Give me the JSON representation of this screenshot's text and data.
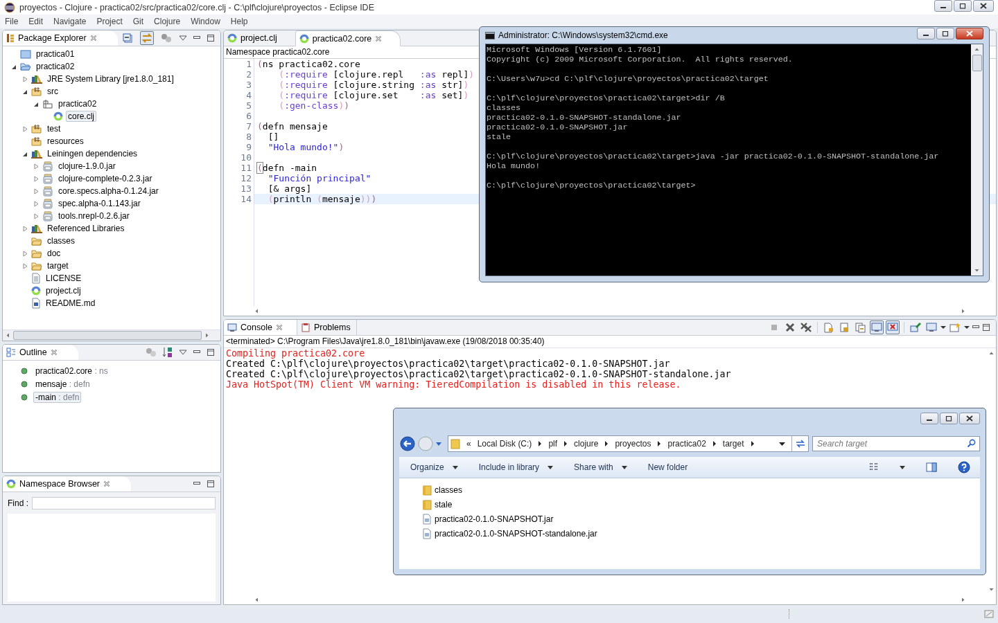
{
  "window": {
    "title": "proyectos - Clojure - practica02/src/practica02/core.clj - C:\\plf\\clojure\\proyectos - Eclipse IDE"
  },
  "menu": [
    "File",
    "Edit",
    "Navigate",
    "Project",
    "Git",
    "Clojure",
    "Window",
    "Help"
  ],
  "package_explorer": {
    "title": "Package Explorer",
    "toolbar": [
      {
        "pressed": false
      },
      {
        "pressed": true
      },
      {
        "pressed": false
      }
    ],
    "tree": [
      {
        "label": "practica01",
        "kind": "project-closed",
        "selected": false
      },
      {
        "label": "practica02",
        "kind": "project",
        "selected": false,
        "expanded": true,
        "children": [
          {
            "label": "JRE System Library [jre1.8.0_181]",
            "kind": "library",
            "selected": false,
            "expanded": false
          },
          {
            "label": "src",
            "kind": "source-folder",
            "selected": false,
            "expanded": true,
            "children": [
              {
                "label": "practica02",
                "kind": "package",
                "selected": false,
                "expanded": true,
                "children": [
                  {
                    "label": "core.clj",
                    "kind": "clj",
                    "selected": true
                  }
                ]
              }
            ]
          },
          {
            "label": "test",
            "kind": "source-folder",
            "selected": false,
            "expanded": false
          },
          {
            "label": "resources",
            "kind": "source-folder",
            "selected": false
          },
          {
            "label": "Leiningen dependencies",
            "kind": "library",
            "selected": false,
            "expanded": true,
            "children": [
              {
                "label": "clojure-1.9.0.jar",
                "kind": "jar",
                "selected": false,
                "expanded": false
              },
              {
                "label": "clojure-complete-0.2.3.jar",
                "kind": "jar",
                "selected": false,
                "expanded": false
              },
              {
                "label": "core.specs.alpha-0.1.24.jar",
                "kind": "jar",
                "selected": false,
                "expanded": false
              },
              {
                "label": "spec.alpha-0.1.143.jar",
                "kind": "jar",
                "selected": false,
                "expanded": false
              },
              {
                "label": "tools.nrepl-0.2.6.jar",
                "kind": "jar",
                "selected": false,
                "expanded": false
              }
            ]
          },
          {
            "label": "Referenced Libraries",
            "kind": "library",
            "selected": false,
            "expanded": false
          },
          {
            "label": "classes",
            "kind": "folder",
            "selected": false
          },
          {
            "label": "doc",
            "kind": "folder",
            "selected": false,
            "expanded": false
          },
          {
            "label": "target",
            "kind": "folder",
            "selected": false,
            "expanded": false
          },
          {
            "label": "LICENSE",
            "kind": "text-file",
            "selected": false
          },
          {
            "label": "project.clj",
            "kind": "clj",
            "selected": false
          },
          {
            "label": "README.md",
            "kind": "word-file",
            "selected": false
          }
        ]
      }
    ]
  },
  "outline": {
    "title": "Outline",
    "items": [
      {
        "name": "practica02.core",
        "type": ": ns",
        "selected": false
      },
      {
        "name": "mensaje",
        "type": ": defn",
        "selected": false
      },
      {
        "name": "-main",
        "type": ": defn",
        "selected": true
      }
    ]
  },
  "namespace_browser": {
    "title": "Namespace Browser",
    "find_label": "Find :"
  },
  "editor": {
    "tabs": [
      {
        "label": "project.clj",
        "selected": false
      },
      {
        "label": "practica02.core",
        "selected": true
      }
    ],
    "breadcrumb": "Namespace practica02.core",
    "lines": [
      {
        "number": "1",
        "current": false,
        "tokens": [
          {
            "kind": "paren1",
            "text": "("
          },
          {
            "kind": "plain",
            "text": "ns practica02.core"
          }
        ]
      },
      {
        "number": "2",
        "current": false,
        "tokens": [
          {
            "kind": "paren2",
            "text": "    ("
          },
          {
            "kind": "keyword",
            "text": ":require"
          },
          {
            "kind": "plain",
            "text": " [clojure.repl   "
          },
          {
            "kind": "keyword",
            "text": ":as"
          },
          {
            "kind": "plain",
            "text": " repl]"
          },
          {
            "kind": "paren2",
            "text": ")"
          }
        ]
      },
      {
        "number": "3",
        "current": false,
        "tokens": [
          {
            "kind": "paren2",
            "text": "    ("
          },
          {
            "kind": "keyword",
            "text": ":require"
          },
          {
            "kind": "plain",
            "text": " [clojure.string "
          },
          {
            "kind": "keyword",
            "text": ":as"
          },
          {
            "kind": "plain",
            "text": " str]"
          },
          {
            "kind": "paren2",
            "text": ")"
          }
        ]
      },
      {
        "number": "4",
        "current": false,
        "tokens": [
          {
            "kind": "paren2",
            "text": "    ("
          },
          {
            "kind": "keyword",
            "text": ":require"
          },
          {
            "kind": "plain",
            "text": " [clojure.set    "
          },
          {
            "kind": "keyword",
            "text": ":as"
          },
          {
            "kind": "plain",
            "text": " set]"
          },
          {
            "kind": "paren2",
            "text": ")"
          }
        ]
      },
      {
        "number": "5",
        "current": false,
        "tokens": [
          {
            "kind": "paren2",
            "text": "    ("
          },
          {
            "kind": "keyword",
            "text": ":gen-class"
          },
          {
            "kind": "paren2",
            "text": ")"
          },
          {
            "kind": "paren1",
            "text": ")"
          }
        ]
      },
      {
        "number": "6",
        "current": false
      },
      {
        "number": "7",
        "current": false,
        "tokens": [
          {
            "kind": "paren1",
            "text": "("
          },
          {
            "kind": "plain",
            "text": "defn mensaje"
          }
        ]
      },
      {
        "number": "8",
        "current": false,
        "tokens": [
          {
            "kind": "plain",
            "text": "  []"
          }
        ]
      },
      {
        "number": "9",
        "current": false,
        "tokens": [
          {
            "kind": "string",
            "text": "  \"Hola mundo!\""
          },
          {
            "kind": "paren1",
            "text": ")"
          }
        ]
      },
      {
        "number": "10",
        "current": false
      },
      {
        "number": "11",
        "current": false,
        "tokens": [
          {
            "kind": "matched",
            "text": "("
          },
          {
            "kind": "plain",
            "text": "defn -main"
          }
        ]
      },
      {
        "number": "12",
        "current": false,
        "tokens": [
          {
            "kind": "string",
            "text": "  \"Función principal\""
          }
        ]
      },
      {
        "number": "13",
        "current": false,
        "tokens": [
          {
            "kind": "plain",
            "text": "  [& args]"
          }
        ]
      },
      {
        "number": "14",
        "current": true,
        "tokens": [
          {
            "kind": "paren2",
            "text": "  ("
          },
          {
            "kind": "plain",
            "text": "println "
          },
          {
            "kind": "paren3",
            "text": "("
          },
          {
            "kind": "plain",
            "text": "mensaje"
          },
          {
            "kind": "paren3",
            "text": ")"
          },
          {
            "kind": "paren2",
            "text": ")"
          },
          {
            "kind": "paren1",
            "text": ")"
          }
        ]
      }
    ]
  },
  "console": {
    "tabs": [
      {
        "label": "Console",
        "selected": true
      },
      {
        "label": "Problems",
        "selected": false
      }
    ],
    "toolbar": [
      {
        "pressed": false
      },
      {
        "pressed": false
      },
      {
        "pressed": false
      },
      {
        "pressed": false
      },
      {
        "pressed": false
      },
      {
        "pressed": false
      },
      {
        "pressed": true
      },
      {
        "pressed": true
      },
      {
        "pressed": false
      },
      {
        "pressed": false
      },
      {
        "pressed": false
      }
    ],
    "process": "<terminated> C:\\Program Files\\Java\\jre1.8.0_181\\bin\\javaw.exe (19/08/2018 00:35:40)",
    "lines": [
      {
        "kind": "error",
        "text": "Compiling practica02.core"
      },
      {
        "kind": "output",
        "text": "Created C:\\plf\\clojure\\proyectos\\practica02\\target\\practica02-0.1.0-SNAPSHOT.jar"
      },
      {
        "kind": "output",
        "text": "Created C:\\plf\\clojure\\proyectos\\practica02\\target\\practica02-0.1.0-SNAPSHOT-standalone.jar"
      },
      {
        "kind": "error",
        "text": "Java HotSpot(TM) Client VM warning: TieredCompilation is disabled in this release."
      }
    ]
  },
  "cmd_window": {
    "title": "Administrator: C:\\Windows\\system32\\cmd.exe",
    "blocks": [
      [
        "Microsoft Windows [Version 6.1.7601]",
        "Copyright (c) 2009 Microsoft Corporation.  All rights reserved."
      ],
      [
        "C:\\Users\\w7u>cd C:\\plf\\clojure\\proyectos\\practica02\\target"
      ],
      [
        "C:\\plf\\clojure\\proyectos\\practica02\\target>dir /B",
        "classes",
        "practica02-0.1.0-SNAPSHOT-standalone.jar",
        "practica02-0.1.0-SNAPSHOT.jar",
        "stale"
      ],
      [
        "C:\\plf\\clojure\\proyectos\\practica02\\target>java -jar practica02-0.1.0-SNAPSHOT-standalone.jar",
        "Hola mundo!"
      ],
      [
        "C:\\plf\\clojure\\proyectos\\practica02\\target>"
      ]
    ]
  },
  "explorer_window": {
    "overflow": "«",
    "path": [
      "Local Disk (C:)",
      "plf",
      "clojure",
      "proyectos",
      "practica02",
      "target"
    ],
    "search": {
      "placeholder": "Search target"
    },
    "commands": [
      {
        "label": "Organize",
        "menu": true
      },
      {
        "label": "Include in library",
        "menu": true
      },
      {
        "label": "Share with",
        "menu": true
      },
      {
        "label": "New folder",
        "menu": false
      }
    ],
    "files": [
      {
        "name": "classes",
        "kind": "folder"
      },
      {
        "name": "stale",
        "kind": "folder"
      },
      {
        "name": "practica02-0.1.0-SNAPSHOT.jar",
        "kind": "file"
      },
      {
        "name": "practica02-0.1.0-SNAPSHOT-standalone.jar",
        "kind": "file"
      }
    ]
  }
}
